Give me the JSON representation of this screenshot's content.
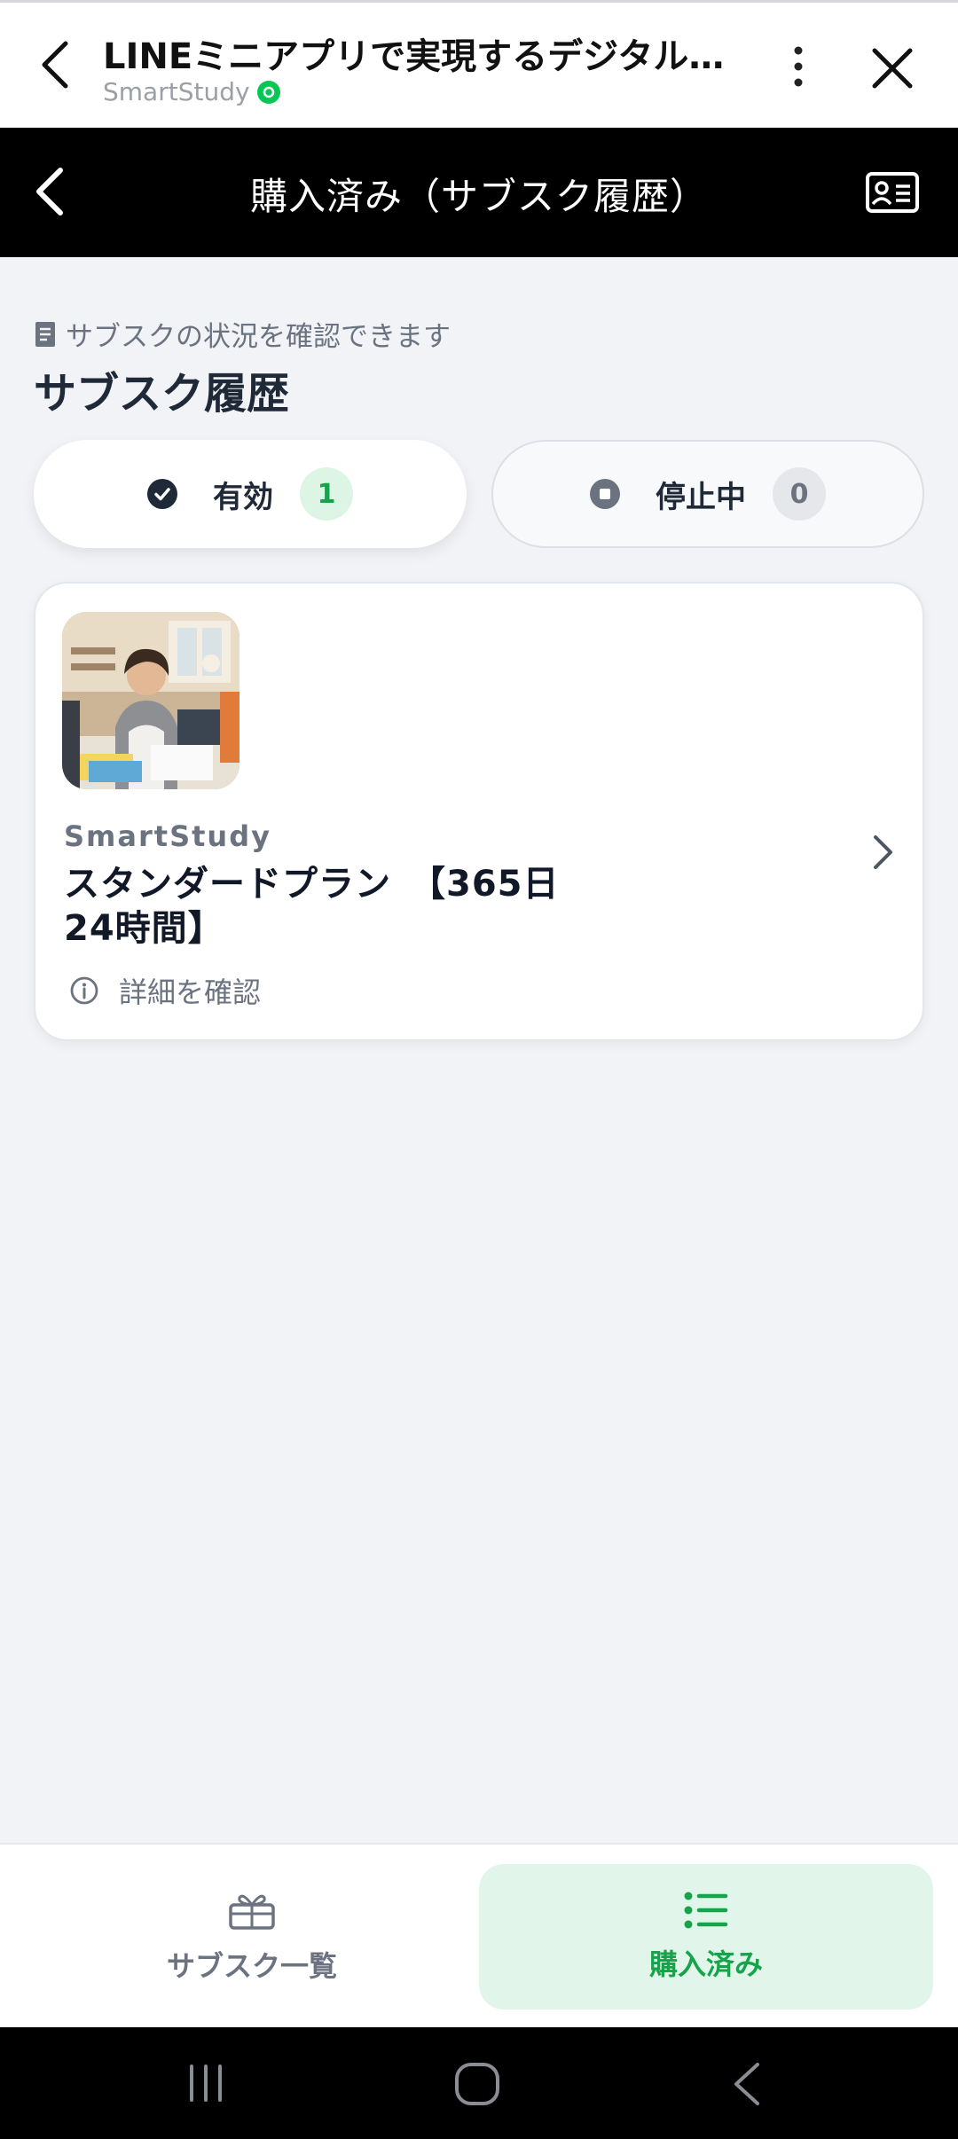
{
  "line_header": {
    "title": "LINEミニアプリで実現するデジタル…",
    "account": "SmartStudy"
  },
  "app_bar": {
    "title": "購入済み（サブスク履歴）"
  },
  "content": {
    "hint": "サブスクの状況を確認できます",
    "title": "サブスク履歴"
  },
  "filters": [
    {
      "label": "有効",
      "count": "1",
      "active": true
    },
    {
      "label": "停止中",
      "count": "0",
      "active": false
    }
  ],
  "subscription": {
    "brand": "SmartStudy",
    "name_line1": "スタンダードプラン　【365日",
    "name_line2": "24時間】",
    "detail_link": "詳細を確認"
  },
  "bottom_nav": {
    "items": [
      {
        "label": "サブスク一覧",
        "icon": "gift-icon",
        "active": false
      },
      {
        "label": "購入済み",
        "icon": "list-icon",
        "active": true
      }
    ]
  },
  "colors": {
    "accent_green": "#16a34a",
    "active_tab_bg": "#e1f5ea",
    "app_bar_bg": "#000000",
    "page_bg": "#f1f3f7"
  }
}
